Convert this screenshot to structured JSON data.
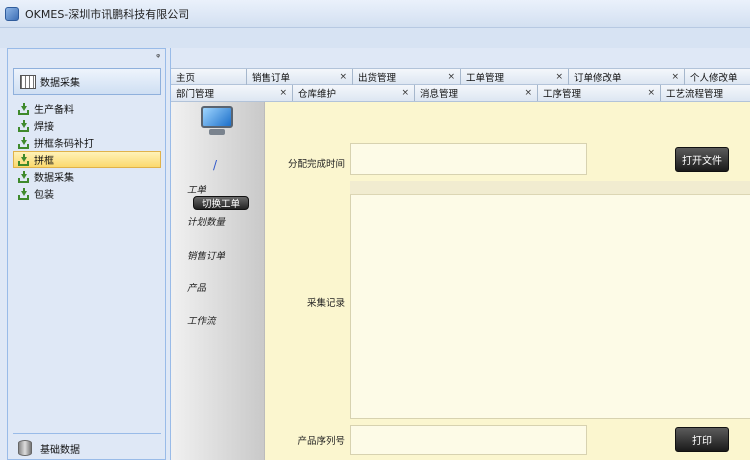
{
  "window": {
    "title": "OKMES-深圳市讯鹏科技有限公司"
  },
  "sidebar": {
    "pin": "ᵠ",
    "header_label": "数据采集",
    "items": [
      {
        "label": "生产备料",
        "selected": false
      },
      {
        "label": "焊接",
        "selected": false
      },
      {
        "label": "拼框条码补打",
        "selected": false
      },
      {
        "label": "拼框",
        "selected": true
      },
      {
        "label": "数据采集",
        "selected": false
      },
      {
        "label": "包装",
        "selected": false
      }
    ],
    "footer_label": "基础数据"
  },
  "tabs": {
    "row1": [
      {
        "label": "主页",
        "closable": false
      },
      {
        "label": "销售订单",
        "closable": true
      },
      {
        "label": "出货管理",
        "closable": true
      },
      {
        "label": "工单管理",
        "closable": true
      },
      {
        "label": "订单修改单",
        "closable": true
      },
      {
        "label": "个人修改单",
        "closable": false
      }
    ],
    "row2": [
      {
        "label": "部门管理",
        "closable": true
      },
      {
        "label": "仓库维护",
        "closable": true
      },
      {
        "label": "消息管理",
        "closable": true
      },
      {
        "label": "工序管理",
        "closable": true
      },
      {
        "label": "工艺流程管理",
        "closable": false
      }
    ],
    "close_glyph": "×"
  },
  "left_strip": {
    "slash": "/",
    "work_order_label": "工单",
    "switch_button": "切换工单",
    "plan_qty_label": "计划数量",
    "sales_order_label": "销售订单",
    "product_label": "产品",
    "workflow_label": "工作流"
  },
  "form": {
    "assign_time_label": "分配完成时间",
    "open_file_button": "打开文件",
    "record_label": "采集记录",
    "serial_label": "产品序列号",
    "print_button": "打印"
  }
}
